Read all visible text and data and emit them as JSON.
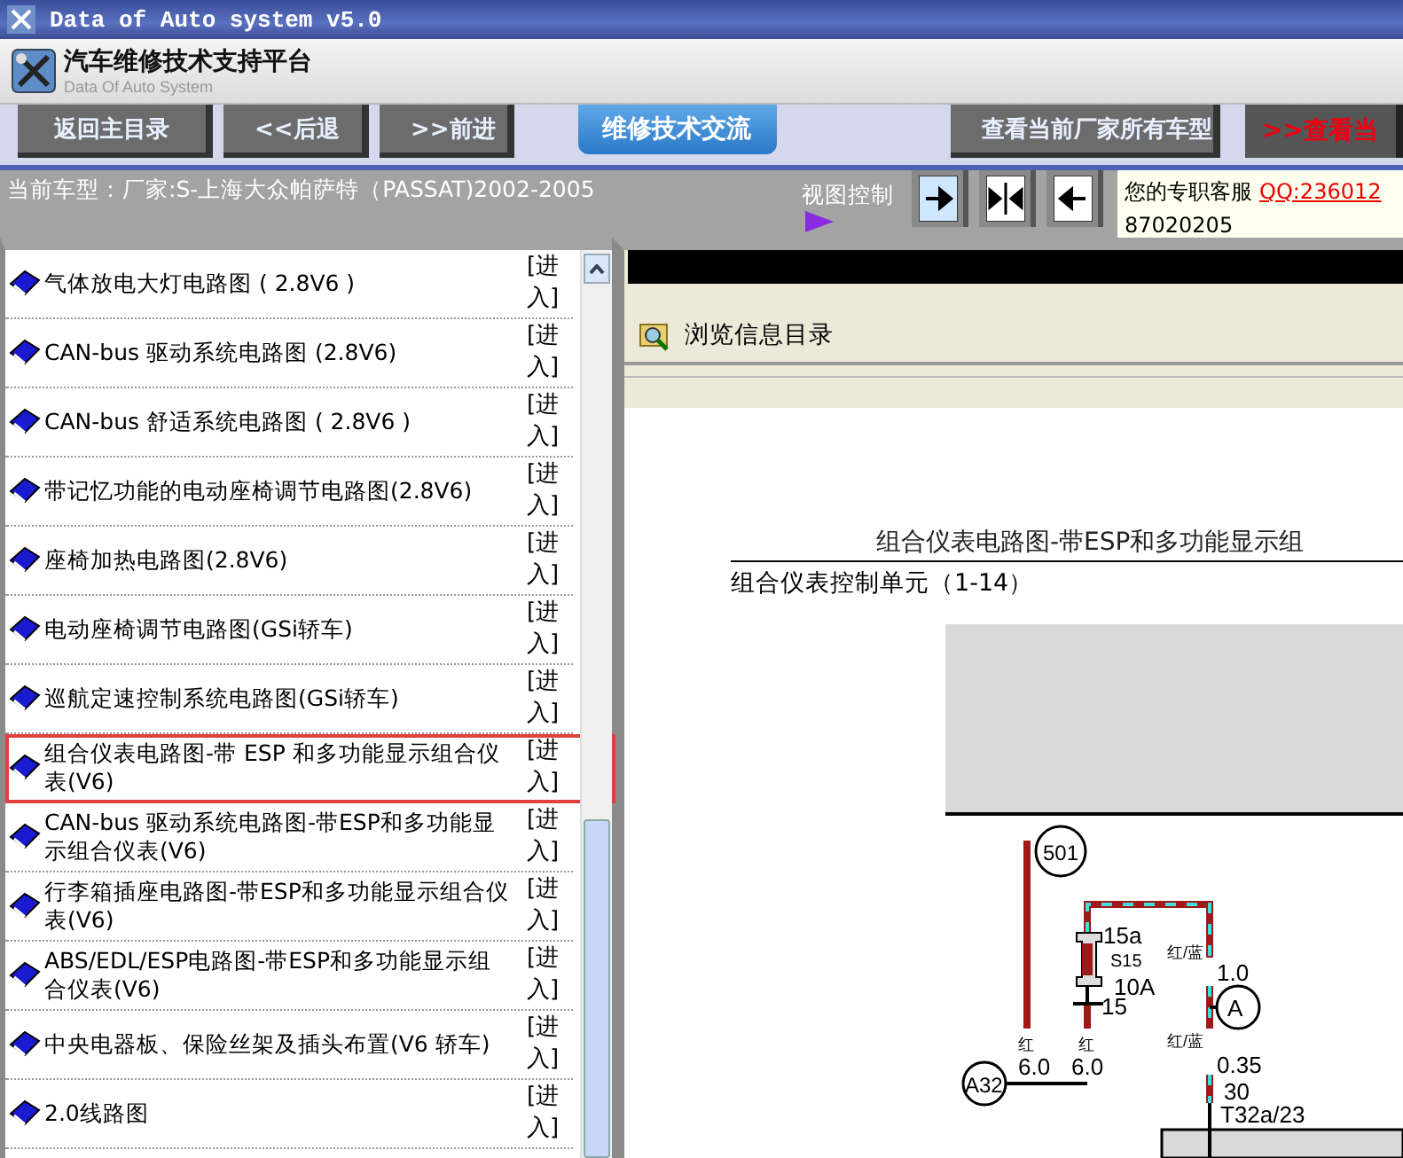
{
  "window": {
    "title": "Data of Auto system v5.0"
  },
  "header": {
    "title": "汽车维修技术支持平台",
    "subtitle": "Data Of Auto System"
  },
  "toolbar": {
    "buttons": [
      {
        "label": "返回主目录",
        "kind": "nav"
      },
      {
        "label": "<<后退",
        "kind": "nav"
      },
      {
        "label": ">>前进",
        "kind": "nav"
      },
      {
        "label": "维修技术交流",
        "kind": "tab"
      },
      {
        "label": "查看当前厂家所有车型",
        "kind": "nav"
      },
      {
        "label": ">>查看当",
        "kind": "promo"
      }
    ]
  },
  "info_bar": {
    "current_model": "当前车型：厂家:S-上海大众帕萨特（PASSAT)2002-2005",
    "view_control": "视图控制",
    "support_label": "您的专职客服",
    "qq": "QQ:236012",
    "phone": "87020205"
  },
  "sidebar": {
    "items": [
      {
        "title": "气体放电大灯电路图 ( 2.8V6 )",
        "action": "[进入]",
        "selected": false
      },
      {
        "title": "CAN-bus 驱动系统电路图 (2.8V6)",
        "action": "[进入]",
        "selected": false
      },
      {
        "title": "CAN-bus 舒适系统电路图 ( 2.8V6 )",
        "action": "[进入]",
        "selected": false
      },
      {
        "title": "带记忆功能的电动座椅调节电路图(2.8V6)",
        "action": "[进入]",
        "selected": false
      },
      {
        "title": "座椅加热电路图(2.8V6)",
        "action": "[进入]",
        "selected": false
      },
      {
        "title": "电动座椅调节电路图(GSi轿车)",
        "action": "[进入]",
        "selected": false
      },
      {
        "title": "巡航定速控制系统电路图(GSi轿车)",
        "action": "[进入]",
        "selected": false
      },
      {
        "title": "组合仪表电路图-带 ESP 和多功能显示组合仪表(V6)",
        "action": "[进入]",
        "selected": true
      },
      {
        "title": "CAN-bus 驱动系统电路图-带ESP和多功能显示组合仪表(V6)",
        "action": "[进入]",
        "selected": false
      },
      {
        "title": "行李箱插座电路图-带ESP和多功能显示组合仪表(V6)",
        "action": "[进入]",
        "selected": false
      },
      {
        "title": "ABS/EDL/ESP电路图-带ESP和多功能显示组合仪表(V6)",
        "action": "[进入]",
        "selected": false
      },
      {
        "title": "中央电器板、保险丝架及插头布置(V6 轿车)",
        "action": "[进入]",
        "selected": false
      },
      {
        "title": "2.0线路图",
        "action": "[进入]",
        "selected": false
      }
    ]
  },
  "content": {
    "toolbar_title": "浏览信息目录",
    "doc_title": "组合仪表电路图-带ESP和多功能显示组",
    "doc_subtitle": "组合仪表控制单元（1-14）",
    "diagram_labels": [
      "501",
      "15a",
      "S15",
      "10A",
      "15",
      "红",
      "6.0",
      "红",
      "6.0",
      "A32",
      "红/蓝",
      "1.0",
      "A",
      "红/蓝",
      "0.35",
      "30",
      "T32a/23"
    ]
  }
}
